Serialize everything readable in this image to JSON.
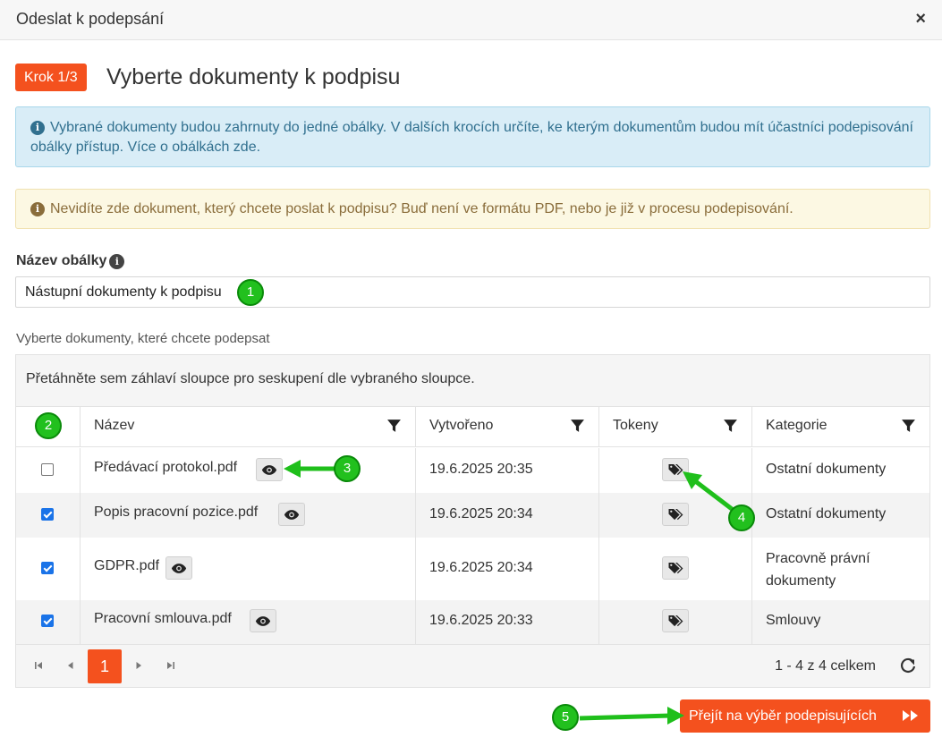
{
  "modal": {
    "title": "Odeslat k podepsání",
    "close_label": "×"
  },
  "step": {
    "badge": "Krok 1/3",
    "title": "Vyberte dokumenty k podpisu"
  },
  "alerts": {
    "info_text": "Vybrané dokumenty budou zahrnuty do jedné obálky. V dalších krocích určíte, ke kterým dokumentům budou mít účastníci podepisování obálky přístup. Více o obálkách zde.",
    "warning_text": "Nevidíte zde dokument, který chcete poslat k podpisu? Buď není ve formátu PDF, nebo je již v procesu podepisování."
  },
  "envelope": {
    "label": "Název obálky",
    "value": "Nástupní dokumenty k podpisu"
  },
  "documents": {
    "label": "Vyberte dokumenty, které chcete podepsat",
    "group_hint": "Přetáhněte sem záhlaví sloupce pro seskupení dle vybraného sloupce.",
    "columns": [
      "Název",
      "Vytvořeno",
      "Tokeny",
      "Kategorie"
    ],
    "rows": [
      {
        "checked": false,
        "name": "Předávací protokol.pdf",
        "created": "19.6.2025 20:35",
        "category": "Ostatní dokumenty"
      },
      {
        "checked": true,
        "name": "Popis pracovní pozice.pdf",
        "created": "19.6.2025 20:34",
        "category": "Ostatní dokumenty"
      },
      {
        "checked": true,
        "name": "GDPR.pdf",
        "created": "19.6.2025 20:34",
        "category": "Pracovně právní dokumenty"
      },
      {
        "checked": true,
        "name": "Pracovní smlouva.pdf",
        "created": "19.6.2025 20:33",
        "category": "Smlouvy"
      }
    ]
  },
  "pager": {
    "current_page": "1",
    "info": "1 - 4 z 4 celkem"
  },
  "next_button": "Přejít na výběr podepisujících",
  "callouts": [
    "1",
    "2",
    "3",
    "4",
    "5"
  ],
  "colors": {
    "accent": "#f4511e",
    "callout_green": "#22c01e",
    "info_bg": "#d9edf7",
    "warning_bg": "#fcf8e3"
  },
  "icons": [
    "close-icon",
    "info-icon",
    "filter-icon",
    "eye-icon",
    "tag-icon",
    "first-page-icon",
    "prev-page-icon",
    "next-page-icon",
    "last-page-icon",
    "refresh-icon",
    "fast-forward-icon"
  ]
}
